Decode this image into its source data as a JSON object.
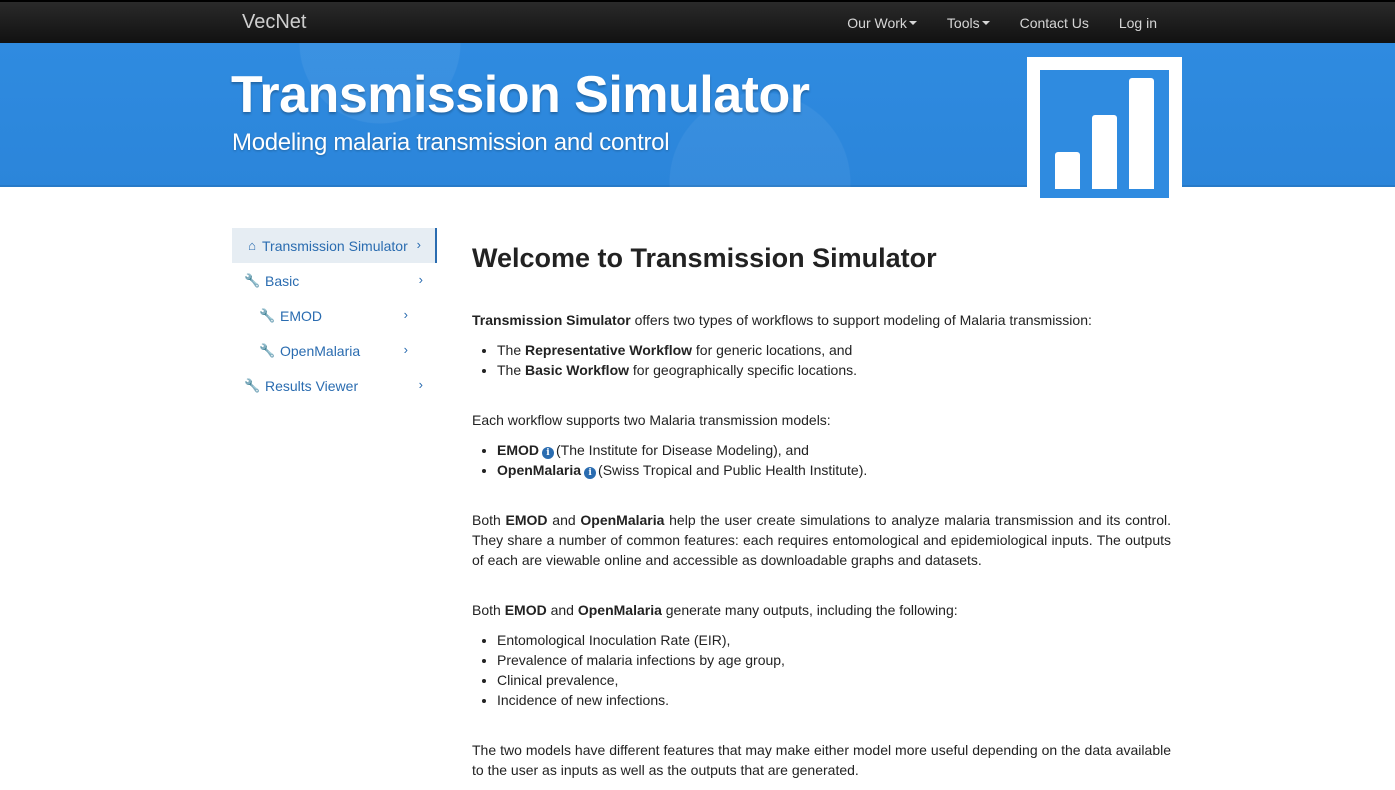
{
  "nav": {
    "brand": "VecNet",
    "items": [
      {
        "label": "Our Work",
        "dropdown": true
      },
      {
        "label": "Tools",
        "dropdown": true
      },
      {
        "label": "Contact Us",
        "dropdown": false
      },
      {
        "label": "Log in",
        "dropdown": false
      }
    ]
  },
  "banner": {
    "title": "Transmission Simulator",
    "subtitle": "Modeling malaria transmission and control",
    "logo_icon": "bar-chart-icon"
  },
  "sidebar": {
    "items": [
      {
        "label": "Transmission Simulator",
        "icon": "home-icon",
        "active": true
      },
      {
        "label": "Basic",
        "icon": "wrench-icon"
      },
      {
        "label": "EMOD",
        "icon": "wrench-icon"
      },
      {
        "label": "OpenMalaria",
        "icon": "wrench-icon"
      },
      {
        "label": "Results Viewer",
        "icon": "wrench-icon"
      }
    ]
  },
  "main": {
    "heading": "Welcome to Transmission Simulator",
    "p1": {
      "bold": "Transmission Simulator",
      "rest": " offers two types of workflows to support modeling of Malaria transmission:"
    },
    "workflows": [
      {
        "pre": "The ",
        "bold": "Representative Workflow",
        "post": " for generic locations, and"
      },
      {
        "pre": "The ",
        "bold": "Basic Workflow",
        "post": " for geographically specific locations."
      }
    ],
    "p2": "Each workflow supports two Malaria transmission models:",
    "models": [
      {
        "bold": "EMOD",
        "post": "(The Institute for Disease Modeling), and"
      },
      {
        "bold": "OpenMalaria",
        "post": "(Swiss Tropical and Public Health Institute)."
      }
    ],
    "p3": {
      "a": "Both ",
      "b1": "EMOD",
      "c": " and ",
      "b2": "OpenMalaria",
      "d": " help the user create simulations to analyze malaria transmission and its control. They share a number of common features: each requires entomological and epidemiological inputs. The outputs of each are viewable online and accessible as downloadable graphs and datasets."
    },
    "p4": {
      "a": "Both ",
      "b1": "EMOD",
      "c": " and ",
      "b2": "OpenMalaria",
      "d": " generate many outputs, including the following:"
    },
    "outputs": [
      "Entomological Inoculation Rate (EIR),",
      "Prevalence of malaria infections by age group,",
      "Clinical prevalence,",
      "Incidence of new infections."
    ],
    "p5": "The two models have different features that may make either model more useful depending on the data available to the user as inputs as well as the outputs that are generated."
  }
}
